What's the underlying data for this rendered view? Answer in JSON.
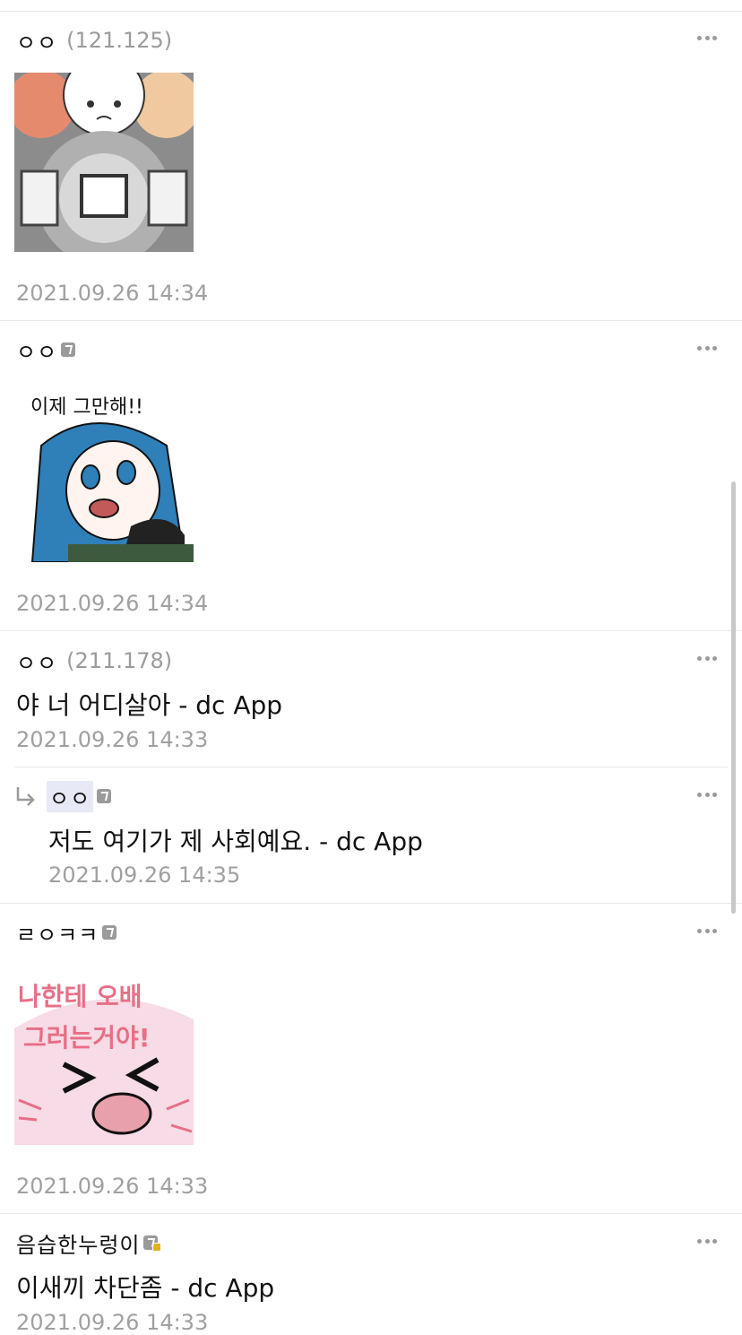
{
  "comments": [
    {
      "nick": "ㅇㅇ",
      "ip": "(121.125)",
      "time": "2021.09.26 14:34",
      "sticker": "bichu-sticker"
    },
    {
      "nick": "ㅇㅇ",
      "time": "2021.09.26 14:34",
      "sticker_text": "이제 그만해!!"
    },
    {
      "nick": "ㅇㅇ",
      "ip": "(211.178)",
      "text": "야 너 어디살아 - dc App",
      "time": "2021.09.26 14:33"
    },
    {
      "nick": "ㅇㅇ",
      "text": "저도 여기가 제 사회예요. - dc App",
      "time": "2021.09.26 14:35",
      "is_reply": true
    },
    {
      "nick": "ㄹㅇㅋㅋ",
      "time": "2021.09.26 14:33",
      "sticker_text_lines": [
        "나한테 오배",
        "그러는거야!"
      ]
    },
    {
      "nick": "음습한누렁이",
      "text": "이새끼 차단좀 - dc App",
      "time": "2021.09.26 14:33"
    }
  ],
  "colors": {
    "accent": "#e8e9f6",
    "muted": "#a0a0a0",
    "divider": "#e9e9e9"
  },
  "icons": {
    "more": "more-options-icon",
    "reply": "reply-arrow-icon",
    "badge": "gallog-badge-icon"
  }
}
